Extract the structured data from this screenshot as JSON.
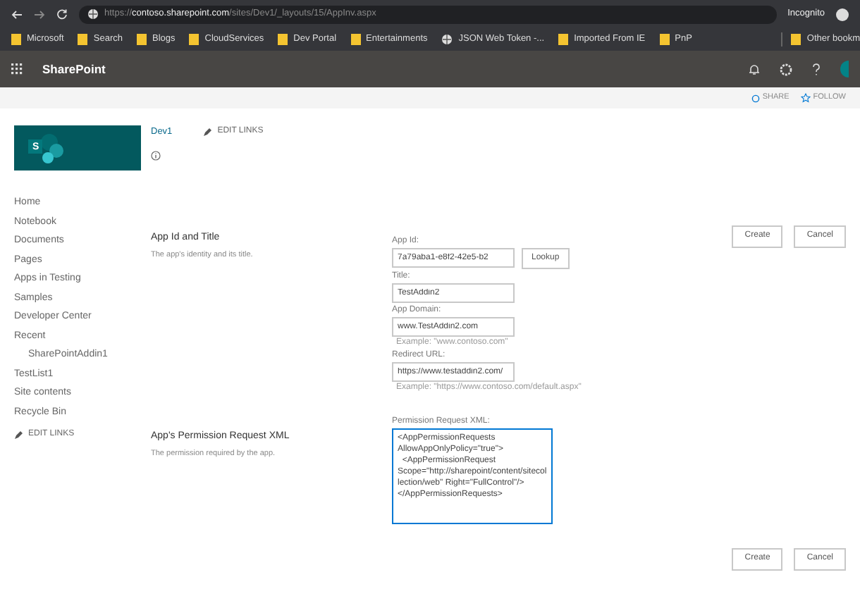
{
  "browser": {
    "url_scheme": "https://",
    "url_host": "contoso.sharepoint.com",
    "url_path": "/sites/Dev1/_layouts/15/AppInv.aspx",
    "profile": "Incognito",
    "bookmarks": [
      {
        "label": "Microsoft",
        "kind": "folder"
      },
      {
        "label": "Search",
        "kind": "folder"
      },
      {
        "label": "Blogs",
        "kind": "folder"
      },
      {
        "label": "CloudServices",
        "kind": "folder"
      },
      {
        "label": "Dev Portal",
        "kind": "folder"
      },
      {
        "label": "Entertainments",
        "kind": "folder"
      },
      {
        "label": "JSON Web Token -...",
        "kind": "site"
      },
      {
        "label": "Imported From IE",
        "kind": "folder"
      },
      {
        "label": "PnP",
        "kind": "folder"
      }
    ],
    "other_bookmarks": "Other bookm"
  },
  "suite_bar": {
    "title": "SharePoint"
  },
  "page_actions": [
    {
      "label": "SHARE",
      "kind": "share"
    },
    {
      "label": "FOLLOW",
      "kind": "follow"
    }
  ],
  "site": {
    "logo_letter": "S",
    "title": "Dev1",
    "edit_links": "EDIT LINKS"
  },
  "nav": {
    "items": [
      {
        "label": "Home"
      },
      {
        "label": "Notebook"
      },
      {
        "label": "Documents"
      },
      {
        "label": "Pages"
      },
      {
        "label": "Apps in Testing"
      },
      {
        "label": "Samples"
      },
      {
        "label": "Developer Center"
      },
      {
        "label": "Recent",
        "children": [
          {
            "label": "SharePointAddin1"
          }
        ]
      },
      {
        "label": "TestList1"
      },
      {
        "label": "Site contents"
      },
      {
        "label": "Recycle Bin"
      }
    ],
    "edit_links": "EDIT LINKS"
  },
  "buttons": [
    "Create",
    "Cancel"
  ],
  "sections": [
    {
      "title": "App Id and Title",
      "description": "The app's identity and its title.",
      "fields": [
        {
          "label": "App Id:",
          "value": "7a79aba1-e8f2-42e5-b2",
          "button": "Lookup"
        },
        {
          "label": "Title:",
          "value": "TestAddin2"
        },
        {
          "label": "App Domain:",
          "value": "www.TestAddin2.com",
          "example": "Example: \"www.contoso.com\""
        },
        {
          "label": "Redirect URL:",
          "value": "https://www.testaddin2.com/",
          "example": "Example: \"https://www.contoso.com/default.aspx\""
        }
      ]
    },
    {
      "title": "App's Permission Request XML",
      "description": "The permission required by the app.",
      "xml": {
        "label": "Permission Request XML:",
        "value": "<AppPermissionRequests AllowAppOnlyPolicy=\"true\">\n  <AppPermissionRequest Scope=\"http://sharepoint/content/sitecollection/web\" Right=\"FullControl\"/>\n</AppPermissionRequests>\n"
      }
    }
  ],
  "bottom_buttons": [
    "Create",
    "Cancel"
  ]
}
